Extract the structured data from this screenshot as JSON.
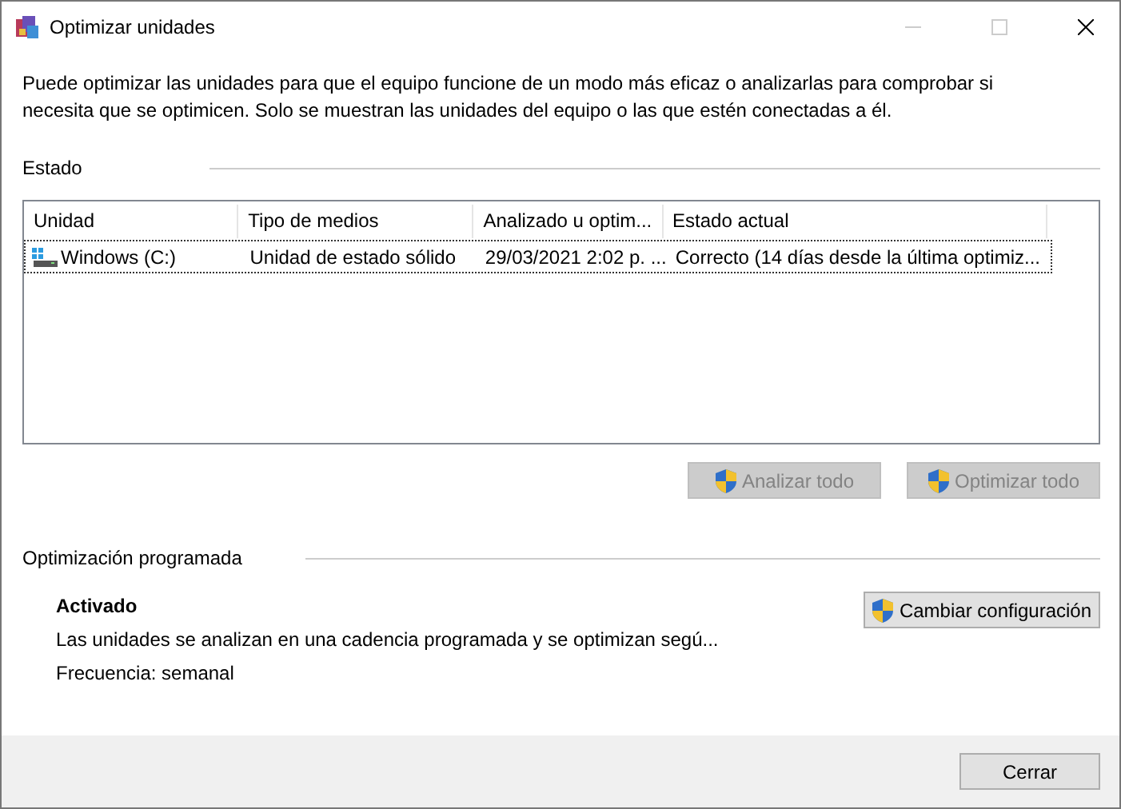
{
  "window": {
    "title": "Optimizar unidades"
  },
  "description": "Puede optimizar las unidades para que el equipo funcione de un modo más eficaz o analizarlas para comprobar si necesita que se optimicen. Solo se muestran las unidades del equipo o las que estén conectadas a él.",
  "status_section": {
    "title": "Estado",
    "table": {
      "columns": [
        "Unidad",
        "Tipo de medios",
        "Analizado u optim...",
        "Estado actual"
      ],
      "rows": [
        {
          "selected": true,
          "cells": [
            "Windows (C:)",
            "Unidad de estado sólido",
            "29/03/2021 2:02 p. ...",
            "Correcto (14 días desde la última optimiz..."
          ]
        }
      ]
    },
    "buttons": [
      {
        "label": "Analizar todo",
        "disabled": true
      },
      {
        "label": "Optimizar todo",
        "disabled": true
      }
    ]
  },
  "schedule_section": {
    "title": "Optimización programada",
    "state": "Activado",
    "description": "Las unidades se analizan en una cadencia programada y se optimizan segú...",
    "frequency": "Frecuencia: semanal",
    "button": {
      "label": "Cambiar configuración",
      "disabled": false
    }
  },
  "footer": {
    "button": {
      "label": "Cerrar",
      "disabled": false
    }
  }
}
